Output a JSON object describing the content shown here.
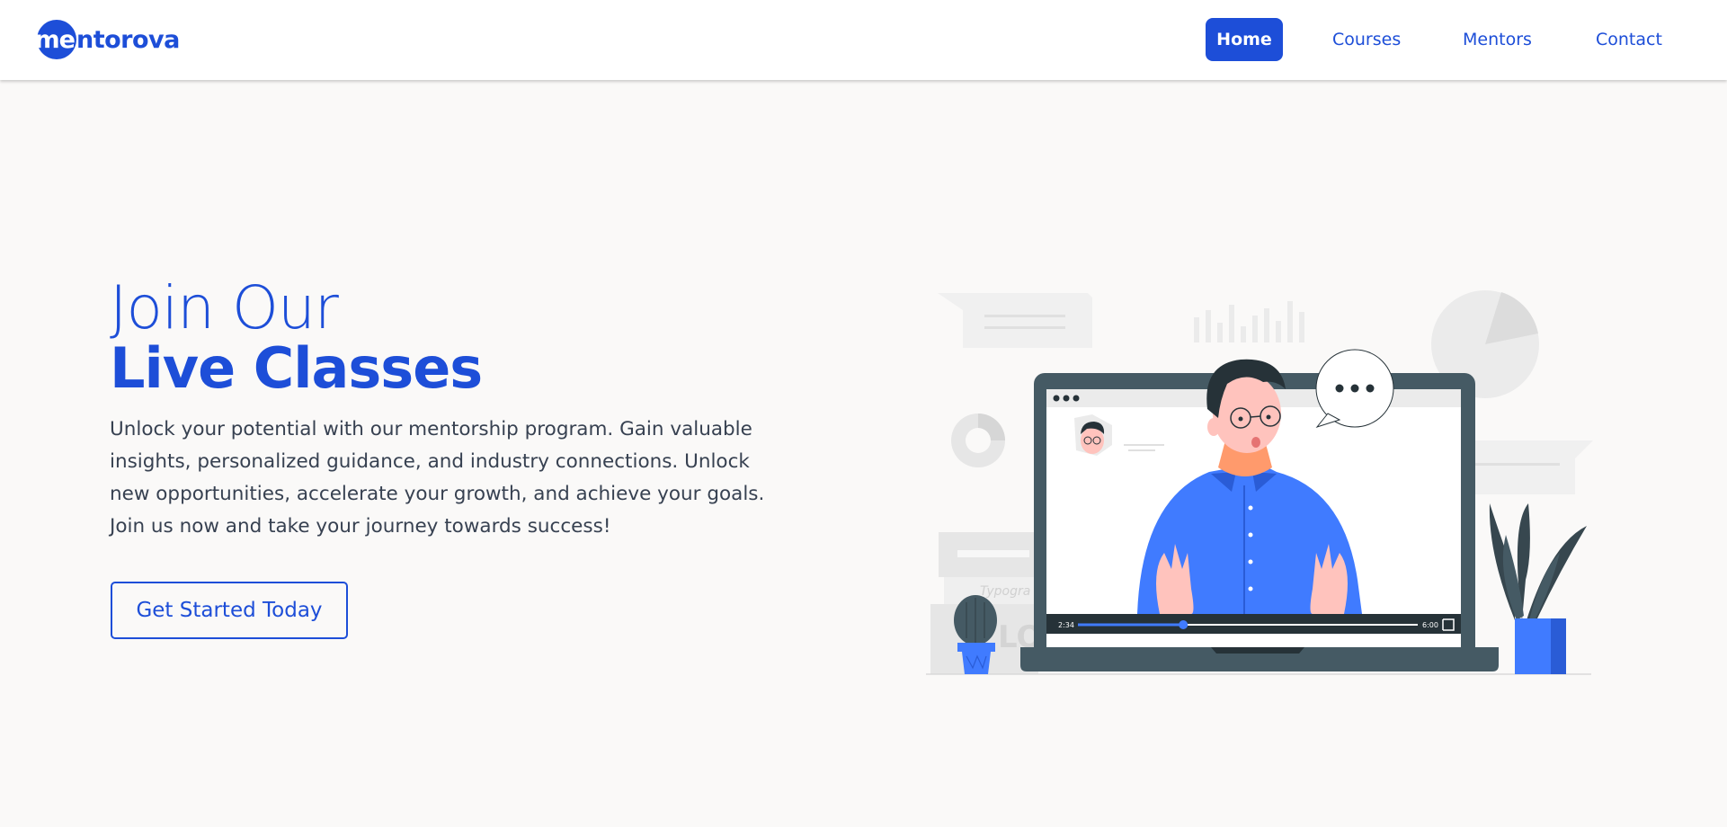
{
  "brand": {
    "logo_initial": "me",
    "logo_rest": "ntorova"
  },
  "nav": {
    "items": [
      {
        "label": "Home",
        "active": true
      },
      {
        "label": "Courses",
        "active": false
      },
      {
        "label": "Mentors",
        "active": false
      },
      {
        "label": "Contact",
        "active": false
      }
    ]
  },
  "hero": {
    "title_light": "Join Our",
    "title_bold": "Live Classes",
    "description": "Unlock your potential with our mentorship program. Gain valuable insights, personalized guidance, and industry connections. Unlock new opportunities, accelerate your growth, and achieve your goals. Join us now and take your journey towards success!",
    "cta_label": "Get Started Today"
  },
  "video_player": {
    "current_time": "2:34",
    "duration": "6:00",
    "progress": 0.31,
    "books_label": "Typogra",
    "books_label2": "LO"
  },
  "colors": {
    "accent": "#1d4ed8",
    "background": "#faf9f8",
    "laptop": "#455a64",
    "shirt": "#407bff"
  },
  "icons": [
    "fullscreen-icon",
    "speech-bubble-icon",
    "cactus-icon",
    "plant-icon"
  ]
}
